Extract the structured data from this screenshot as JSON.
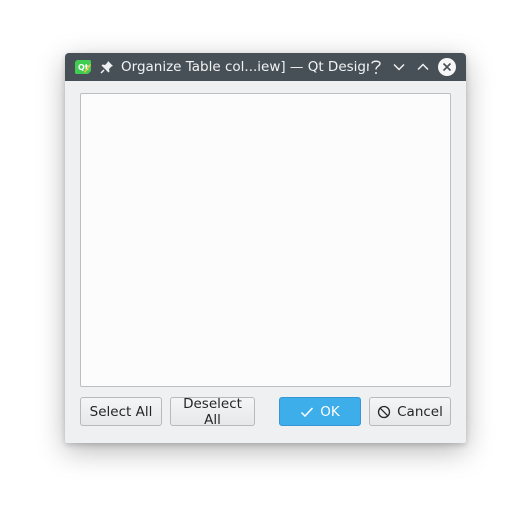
{
  "window": {
    "title": "Organize Table col...iew] — Qt Designer",
    "titlebar_icons": [
      "qt-designer-app-icon",
      "pin-icon",
      "help-icon",
      "minimize-icon",
      "maximize-icon",
      "close-icon"
    ]
  },
  "list": {
    "items": []
  },
  "buttons": {
    "select_all": "Select All",
    "deselect_all": "Deselect All",
    "ok": "OK",
    "cancel": "Cancel"
  },
  "colors": {
    "titlebar": "#475057",
    "window_bg": "#eff0f1",
    "accent": "#3daee9",
    "list_bg": "#fcfcfc"
  }
}
